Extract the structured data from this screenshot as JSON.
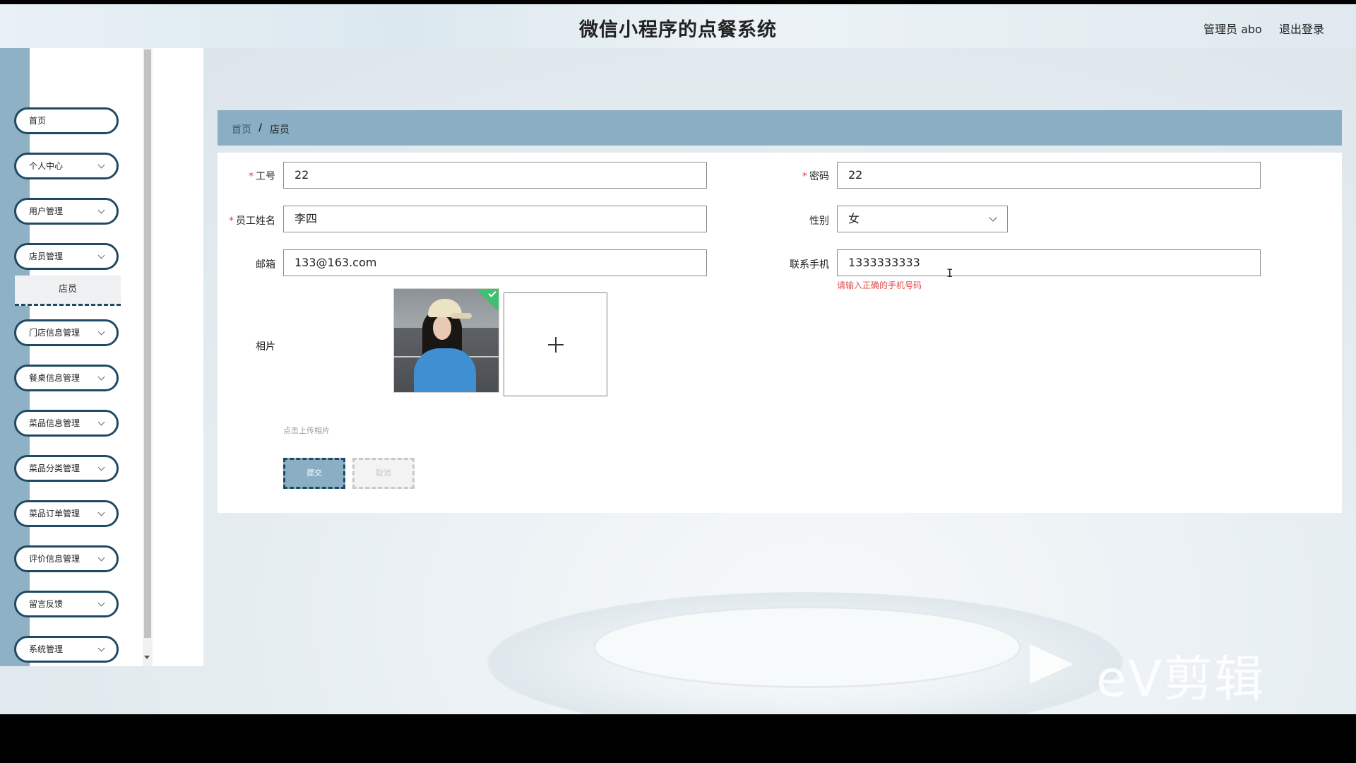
{
  "header": {
    "title": "微信小程序的点餐系统",
    "user": "管理员 abo",
    "logout": "退出登录"
  },
  "sidebar": {
    "items": [
      {
        "label": "首页"
      },
      {
        "label": "个人中心"
      },
      {
        "label": "用户管理"
      },
      {
        "label": "店员管理"
      },
      {
        "label": "门店信息管理"
      },
      {
        "label": "餐桌信息管理"
      },
      {
        "label": "菜品信息管理"
      },
      {
        "label": "菜品分类管理"
      },
      {
        "label": "菜品订单管理"
      },
      {
        "label": "评价信息管理"
      },
      {
        "label": "留言反馈"
      },
      {
        "label": "系统管理"
      }
    ],
    "submenu": "店员"
  },
  "breadcrumb": {
    "home": "首页",
    "sep": "/",
    "current": "店员"
  },
  "form": {
    "employee_id": {
      "label": "工号",
      "value": "22"
    },
    "password": {
      "label": "密码",
      "value": "22"
    },
    "name": {
      "label": "员工姓名",
      "value": "李四"
    },
    "gender": {
      "label": "性别",
      "value": "女"
    },
    "email": {
      "label": "邮箱",
      "value": "133@163.com"
    },
    "phone": {
      "label": "联系手机",
      "value": "1333333333",
      "error": "请输入正确的手机号码"
    },
    "photo": {
      "label": "相片",
      "hint": "点击上传相片"
    },
    "submit": "提交",
    "cancel": "取消",
    "required_mark": "*"
  },
  "watermark": "eV剪辑",
  "colors": {
    "accent": "#8aaec4",
    "border_dark": "#1f4a63",
    "error": "#e04a4a"
  }
}
